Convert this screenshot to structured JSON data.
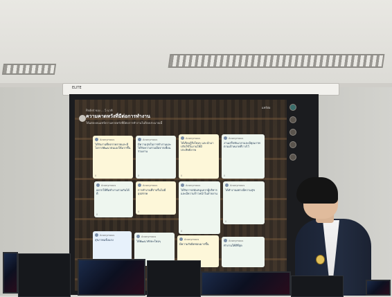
{
  "scene": {
    "housing_label": "ELITE",
    "presentation": {
      "header_small": "Padlet ของ ... 5 นาที",
      "title": "ความคาดหวังที่มีต่อการทำงาน",
      "description": "ให้แต่ละคนแชร์ความคาดหวังที่มีต่อการทำงานในปีงบประมาณนี้",
      "top_right_label": "แชร์ต่อ"
    },
    "cards": [
      {
        "user": "Anonymous",
        "text": "ได้รับงานที่หลากหลายและมีโอกาสพัฒนาตนเองให้มากขึ้น",
        "likes": "0",
        "color": "yellow"
      },
      {
        "user": "Anonymous",
        "text": "มีความสุขในการทำงานและได้รับความร่วมมือจากเพื่อนร่วมงาน",
        "likes": "0",
        "color": "green"
      },
      {
        "user": "Anonymous",
        "text": "ได้เรียนรู้สิ่งใหม่ๆ และนำมาปรับใช้ในงานให้มีประสิทธิภาพ",
        "likes": "0",
        "color": "yellow"
      },
      {
        "user": "Anonymous",
        "text": "งานเสร็จทันเวลาและมีคุณภาพตามเป้าหมายที่วางไว้",
        "likes": "0",
        "color": "green"
      },
      {
        "user": "Anonymous",
        "text": "อยากให้ทีมทำงานร่วมกันได้ดี",
        "likes": "0",
        "color": "green"
      },
      {
        "user": "Anonymous",
        "text": "การทำงานที่ราบรื่นไม่มีอุปสรรค",
        "likes": "0",
        "color": "yellow"
      },
      {
        "user": "Anonymous",
        "text": "ได้รับการสนับสนุนจากผู้บริหารและมีความก้าวหน้าในสายงาน",
        "likes": "0",
        "color": "green"
      },
      {
        "user": "Anonymous",
        "text": "ได้ทำงานอย่างมีความสุข",
        "likes": "0",
        "color": "green"
      },
      {
        "user": "Anonymous",
        "text": "สุขภาพแข็งแรง",
        "likes": "0",
        "color": "blue"
      },
      {
        "user": "Anonymous",
        "text": "ได้พัฒนาทักษะใหม่ๆ",
        "likes": "0",
        "color": "green"
      },
      {
        "user": "Anonymous",
        "text": "มีความรับผิดชอบมากขึ้น",
        "likes": "0",
        "color": "yellow"
      },
      {
        "user": "Anonymous",
        "text": "ทำงานให้ดีที่สุด",
        "likes": "0",
        "color": "green"
      }
    ],
    "colors": {
      "ceiling": "#e9e8e3",
      "wall": "#c9c9c4",
      "screen_frame": "#1b1c1f",
      "suit": "#1a2233",
      "card_green": "#eef6ef",
      "card_yellow": "#fdf7d9"
    }
  }
}
